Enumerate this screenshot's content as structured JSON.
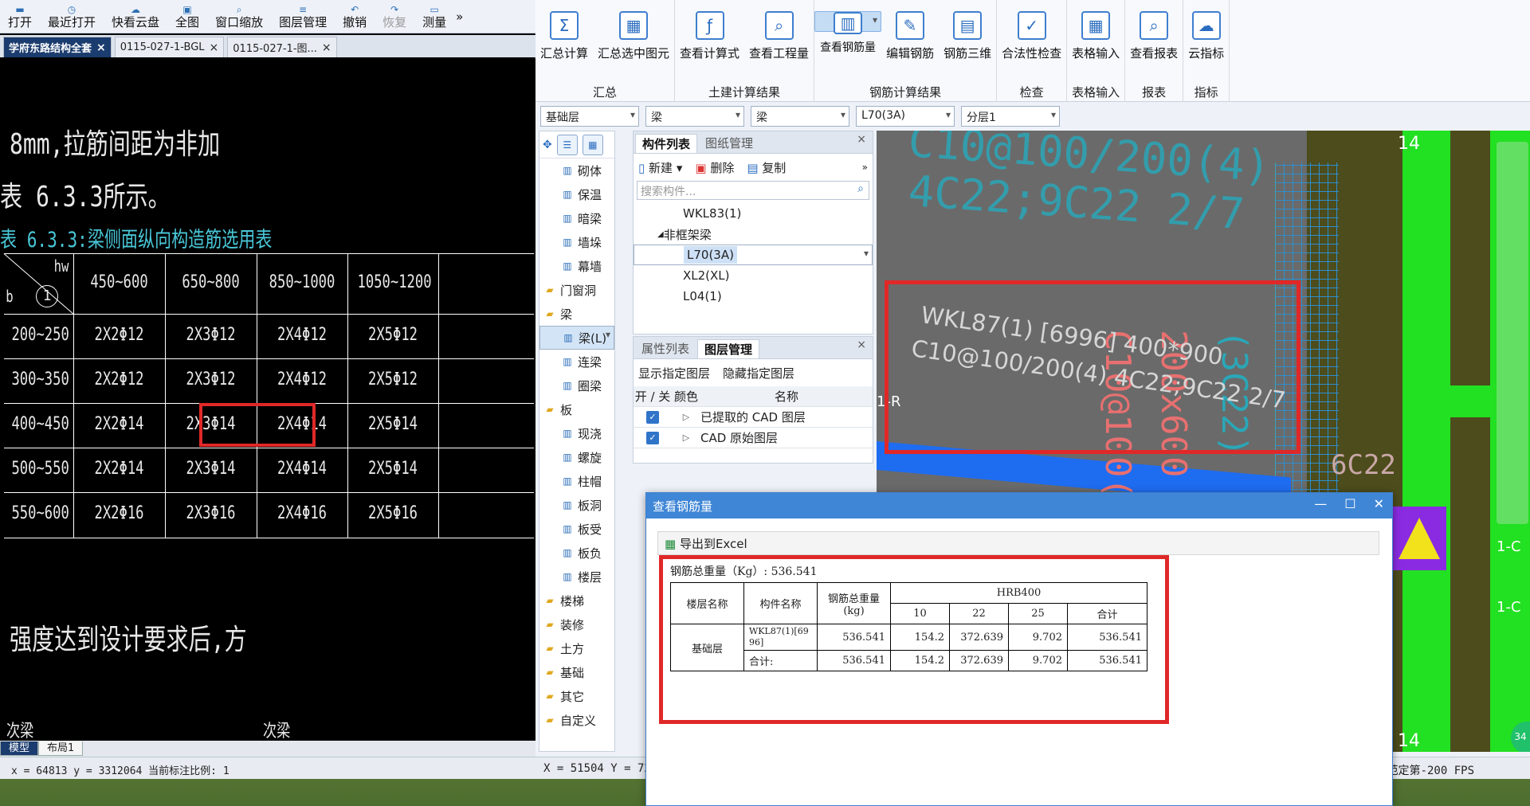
{
  "cad": {
    "toolbar": [
      "打开",
      "最近打开",
      "快看云盘",
      "全图",
      "窗口缩放",
      "图层管理",
      "撤销",
      "恢复",
      "测量"
    ],
    "more_icon": "»",
    "tabs": [
      {
        "label": "学府东路结构全套"
      },
      {
        "label": "0115-027-1-BGL"
      },
      {
        "label": "0115-027-1-图..."
      }
    ],
    "lines": {
      "l1": "8mm,拉筋间距为非加",
      "l2": "表 6.3.3所示。",
      "l3": "表 6.3.3:梁侧面纵向构造筋选用表",
      "l4": "强度达到设计要求后,方",
      "l5": "次梁",
      "l6": "次梁"
    },
    "table": {
      "corner_hw": "hw",
      "corner_b": "b",
      "corner_num": "1",
      "cols": [
        "450~600",
        "650~800",
        "850~1000",
        "1050~1200"
      ],
      "rows": [
        {
          "b": "200~250",
          "v": [
            "2X2Φ12",
            "2X3Φ12",
            "2X4Φ12",
            "2X5Φ12"
          ]
        },
        {
          "b": "300~350",
          "v": [
            "2X2Φ12",
            "2X3Φ12",
            "2X4Φ12",
            "2X5Φ12"
          ]
        },
        {
          "b": "400~450",
          "v": [
            "2X2Φ14",
            "2X3Φ14",
            "2X4Φ14",
            "2X5Φ14"
          ]
        },
        {
          "b": "500~550",
          "v": [
            "2X2Φ14",
            "2X3Φ14",
            "2X4Φ14",
            "2X5Φ14"
          ]
        },
        {
          "b": "550~600",
          "v": [
            "2X2Φ16",
            "2X3Φ16",
            "2X4Φ16",
            "2X5Φ16"
          ]
        }
      ]
    },
    "model_tabs": [
      "模型",
      "布局1"
    ],
    "status": "x = 64813 y = 3312064 当前标注比例: 1"
  },
  "glodon": {
    "ribbon_groups": [
      {
        "title": "汇总",
        "buttons": [
          {
            "label": "汇总计算",
            "icon": "sigma-icon",
            "glyph": "Σ"
          },
          {
            "label": "汇总选中图元",
            "icon": "summary-icon",
            "glyph": "▦"
          }
        ]
      },
      {
        "title": "土建计算结果",
        "buttons": [
          {
            "label": "查看计算式",
            "icon": "formula-icon",
            "glyph": "ƒ"
          },
          {
            "label": "查看工程量",
            "icon": "quantity-icon",
            "glyph": "⌕"
          }
        ]
      },
      {
        "title": "钢筋计算结果",
        "buttons": [
          {
            "label": "查看钢筋量",
            "icon": "rebar-view-icon",
            "glyph": "▥",
            "selected": true
          },
          {
            "label": "编辑钢筋",
            "icon": "rebar-edit-icon",
            "glyph": "✎"
          },
          {
            "label": "钢筋三维",
            "icon": "rebar-3d-icon",
            "glyph": "▤"
          }
        ]
      },
      {
        "title": "检查",
        "buttons": [
          {
            "label": "合法性检查",
            "icon": "check-icon",
            "glyph": "✓"
          }
        ]
      },
      {
        "title": "表格输入",
        "buttons": [
          {
            "label": "表格输入",
            "icon": "table-input-icon",
            "glyph": "▦"
          }
        ]
      },
      {
        "title": "报表",
        "buttons": [
          {
            "label": "查看报表",
            "icon": "report-icon",
            "glyph": "⌕"
          }
        ]
      },
      {
        "title": "指标",
        "buttons": [
          {
            "label": "云指标",
            "icon": "cloud-icon",
            "glyph": "☁"
          }
        ]
      }
    ],
    "filters": [
      "基础层",
      "梁",
      "梁",
      "L70(3A)",
      "分层1"
    ],
    "nav": [
      {
        "label": "砌体",
        "type": "sub"
      },
      {
        "label": "保温",
        "type": "sub"
      },
      {
        "label": "暗梁",
        "type": "sub"
      },
      {
        "label": "墙垛",
        "type": "sub"
      },
      {
        "label": "幕墙",
        "type": "sub"
      },
      {
        "label": "门窗洞",
        "type": "grp"
      },
      {
        "label": "梁",
        "type": "grp"
      },
      {
        "label": "梁(L)",
        "type": "sub",
        "selected": true
      },
      {
        "label": "连梁",
        "type": "sub"
      },
      {
        "label": "圈梁",
        "type": "sub"
      },
      {
        "label": "板",
        "type": "grp"
      },
      {
        "label": "现浇",
        "type": "sub"
      },
      {
        "label": "螺旋",
        "type": "sub"
      },
      {
        "label": "柱帽",
        "type": "sub"
      },
      {
        "label": "板洞",
        "type": "sub"
      },
      {
        "label": "板受",
        "type": "sub"
      },
      {
        "label": "板负",
        "type": "sub"
      },
      {
        "label": "楼层",
        "type": "sub"
      },
      {
        "label": "楼梯",
        "type": "grp"
      },
      {
        "label": "装修",
        "type": "grp"
      },
      {
        "label": "土方",
        "type": "grp"
      },
      {
        "label": "基础",
        "type": "grp"
      },
      {
        "label": "其它",
        "type": "grp"
      },
      {
        "label": "自定义",
        "type": "grp"
      }
    ],
    "comp_panel": {
      "tabs": [
        "构件列表",
        "图纸管理"
      ],
      "new_label": "新建",
      "delete_label": "删除",
      "copy_label": "复制",
      "search_placeholder": "搜索构件...",
      "items": [
        {
          "label": "WKL83(1)",
          "indent": 2
        },
        {
          "label": "非框架梁",
          "indent": 1,
          "group": true
        },
        {
          "label": "L70(3A)",
          "indent": 2,
          "selected": true
        },
        {
          "label": "XL2(XL)",
          "indent": 2
        },
        {
          "label": "L04(1)",
          "indent": 2
        }
      ]
    },
    "layer_panel": {
      "tabs": [
        "属性列表",
        "图层管理"
      ],
      "show_label": "显示指定图层",
      "hide_label": "隐藏指定图层",
      "col_onoff": "开 / 关",
      "col_color": "颜色",
      "col_name": "名称",
      "rows": [
        {
          "name": "已提取的 CAD 图层"
        },
        {
          "name": "CAD 原始图层"
        }
      ]
    },
    "canvas": {
      "beam_line1": "WKL87(1) [6996] 400*900",
      "beam_line2": "C10@100/200(4) 4C22;9C22 2/7",
      "top_text": "C10@100/200(4)",
      "top_text2": "4C22;9C22 2/7",
      "axis14_top": "14",
      "axis14_bottom": "14",
      "label_6c22": "6C22",
      "label_1r": "1-R",
      "label_1c_a": "1-C",
      "label_1c_b": "1-C",
      "vert_text": "C10@100(2)",
      "vert_text2": "200x600",
      "vert_text3": "(3C22)",
      "badge": "34"
    },
    "status": "X = 51504 Y = 72",
    "status_right": "范定第-200 FPS"
  },
  "dialog": {
    "title": "查看钢筋量",
    "export_label": "导出到Excel",
    "total_weight": "钢筋总重量（Kg）: 536.541",
    "headers": {
      "floor": "楼层名称",
      "comp": "构件名称",
      "total": "钢筋总重量(kg)",
      "grade": "HRB400",
      "d10": "10",
      "d22": "22",
      "d25": "25",
      "sum": "合计"
    },
    "floor": "基础层",
    "rows": [
      {
        "comp": "WKL87(1)[6996]",
        "total": "536.541",
        "d10": "154.2",
        "d22": "372.639",
        "d25": "9.702",
        "sum": "536.541"
      },
      {
        "comp": "合计:",
        "total": "536.541",
        "d10": "154.2",
        "d22": "372.639",
        "d25": "9.702",
        "sum": "536.541"
      }
    ]
  },
  "colors": {
    "highlight": "#e02828",
    "cad_cyan": "#49c7d7",
    "canvas_olive": "#4e4e1a",
    "green": "#21e021",
    "blue": "#1a73e8"
  }
}
